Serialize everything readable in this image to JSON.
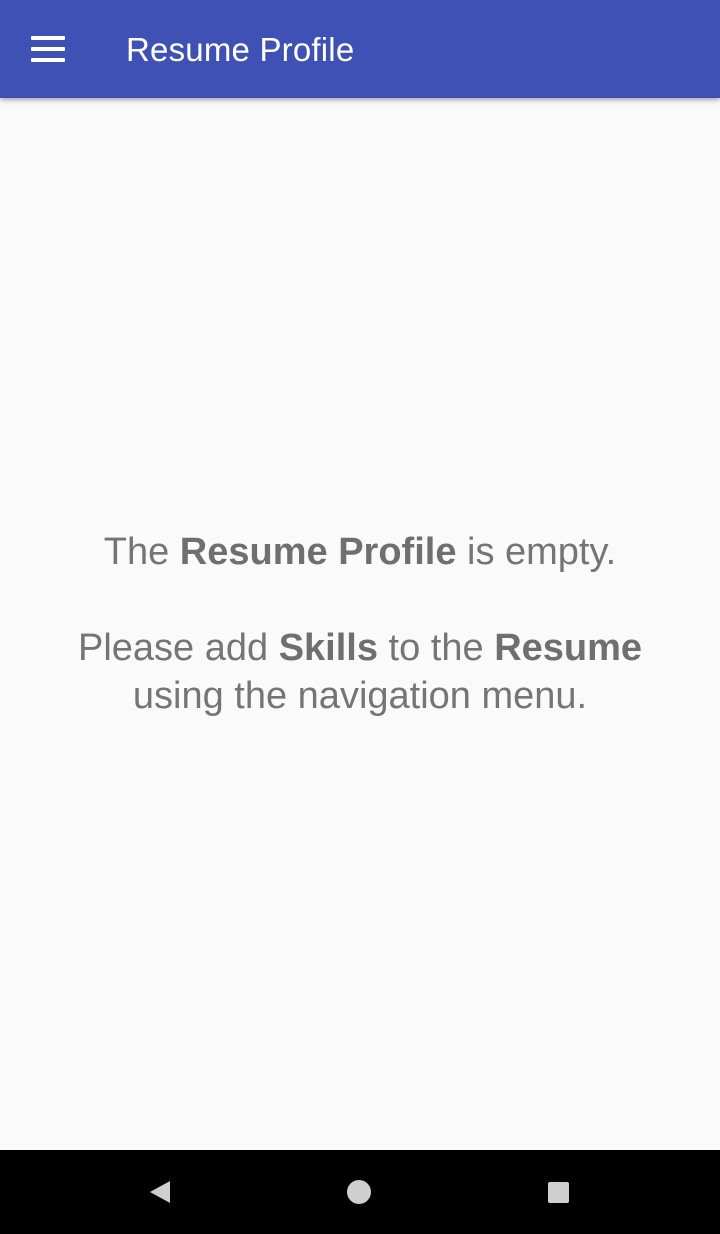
{
  "app_bar": {
    "title": "Resume Profile",
    "menu_icon": "hamburger-menu-icon",
    "color": "#3f51b5"
  },
  "empty_state": {
    "line1": {
      "prefix": "The ",
      "bold": "Resume Profile",
      "suffix": " is empty."
    },
    "line2": {
      "part1": "Please add ",
      "bold1": "Skills",
      "part2": " to the ",
      "bold2": "Resume",
      "part3": " using the navigation menu."
    }
  },
  "system_nav": {
    "back_icon": "back-triangle-icon",
    "home_icon": "home-circle-icon",
    "recents_icon": "recents-square-icon"
  }
}
